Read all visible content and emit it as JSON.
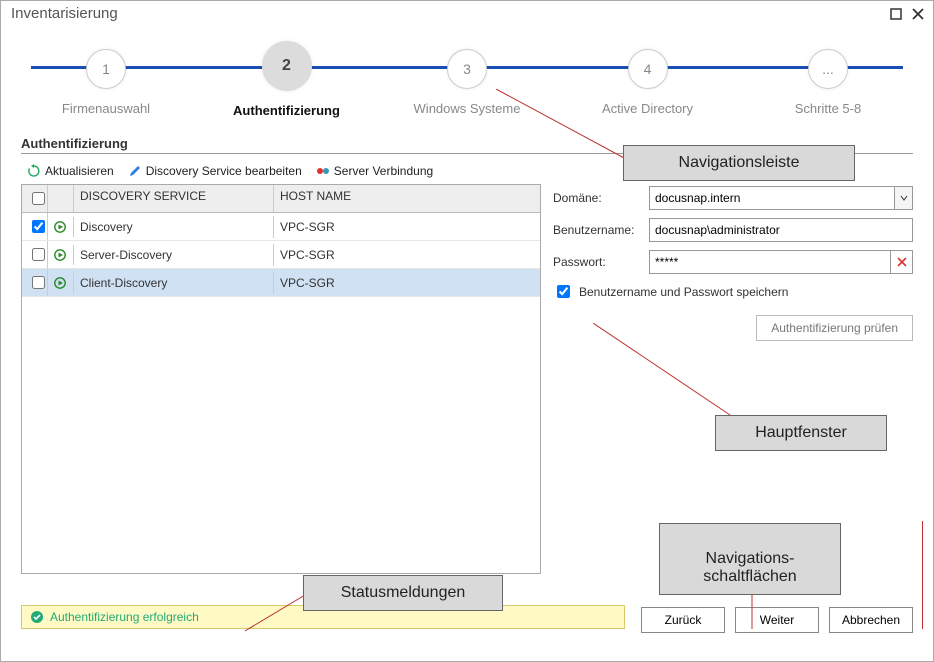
{
  "window": {
    "title": "Inventarisierung"
  },
  "stepper": {
    "steps": [
      {
        "num": "1",
        "label": "Firmenauswahl",
        "active": false
      },
      {
        "num": "2",
        "label": "Authentifizierung",
        "active": true
      },
      {
        "num": "3",
        "label": "Windows Systeme",
        "active": false
      },
      {
        "num": "4",
        "label": "Active Directory",
        "active": false
      },
      {
        "num": "...",
        "label": "Schritte 5-8",
        "active": false
      }
    ]
  },
  "section": {
    "title": "Authentifizierung"
  },
  "toolbar": {
    "refresh": "Aktualisieren",
    "edit": "Discovery Service bearbeiten",
    "conn": "Server Verbindung"
  },
  "table": {
    "headers": {
      "service": "DISCOVERY SERVICE",
      "host": "HOST NAME"
    },
    "rows": [
      {
        "checked": true,
        "name": "Discovery",
        "host": "VPC-SGR",
        "selected": false
      },
      {
        "checked": false,
        "name": "Server-Discovery",
        "host": "VPC-SGR",
        "selected": false
      },
      {
        "checked": false,
        "name": "Client-Discovery",
        "host": "VPC-SGR",
        "selected": true
      }
    ]
  },
  "form": {
    "domain_label": "Domäne:",
    "domain_value": "docusnap.intern",
    "user_label": "Benutzername:",
    "user_value": "docusnap\\administrator",
    "pw_label": "Passwort:",
    "pw_value": "*****",
    "save_creds_label": "Benutzername und Passwort speichern",
    "save_creds_checked": true,
    "auth_check_btn": "Authentifizierung prüfen"
  },
  "status": {
    "text": "Authentifizierung erfolgreich"
  },
  "nav": {
    "back": "Zurück",
    "next": "Weiter",
    "cancel": "Abbrechen"
  },
  "callouts": {
    "nav_bar": "Navigationsleiste",
    "main_window": "Hauptfenster",
    "status_msg": "Statusmeldungen",
    "nav_buttons": "Navigations-\nschaltflächen"
  }
}
